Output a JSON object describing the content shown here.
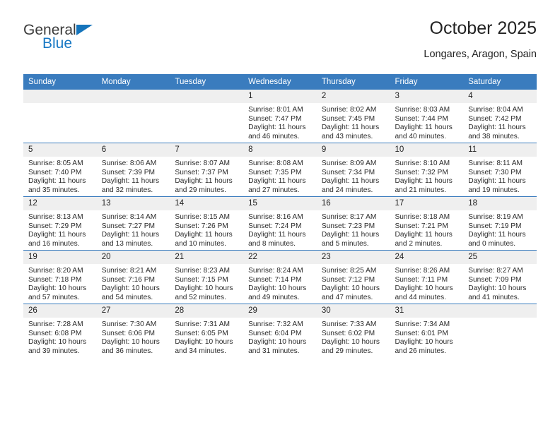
{
  "brand": {
    "name_top": "General",
    "name_bottom": "Blue",
    "accent_color": "#1878c4",
    "triangle_color": "#1574bb"
  },
  "header": {
    "title": "October 2025",
    "subtitle": "Longares, Aragon, Spain"
  },
  "theme": {
    "header_row_bg": "#3a7cbe",
    "daynum_bg": "#efefef",
    "cell_bg": "#ffffff",
    "text_color": "#2b2b2b"
  },
  "weekdays": [
    "Sunday",
    "Monday",
    "Tuesday",
    "Wednesday",
    "Thursday",
    "Friday",
    "Saturday"
  ],
  "weeks": [
    [
      {
        "day": "",
        "empty": true
      },
      {
        "day": "",
        "empty": true
      },
      {
        "day": "",
        "empty": true
      },
      {
        "day": "1",
        "sunrise": "Sunrise: 8:01 AM",
        "sunset": "Sunset: 7:47 PM",
        "daylight_1": "Daylight: 11 hours",
        "daylight_2": "and 46 minutes."
      },
      {
        "day": "2",
        "sunrise": "Sunrise: 8:02 AM",
        "sunset": "Sunset: 7:45 PM",
        "daylight_1": "Daylight: 11 hours",
        "daylight_2": "and 43 minutes."
      },
      {
        "day": "3",
        "sunrise": "Sunrise: 8:03 AM",
        "sunset": "Sunset: 7:44 PM",
        "daylight_1": "Daylight: 11 hours",
        "daylight_2": "and 40 minutes."
      },
      {
        "day": "4",
        "sunrise": "Sunrise: 8:04 AM",
        "sunset": "Sunset: 7:42 PM",
        "daylight_1": "Daylight: 11 hours",
        "daylight_2": "and 38 minutes."
      }
    ],
    [
      {
        "day": "5",
        "sunrise": "Sunrise: 8:05 AM",
        "sunset": "Sunset: 7:40 PM",
        "daylight_1": "Daylight: 11 hours",
        "daylight_2": "and 35 minutes."
      },
      {
        "day": "6",
        "sunrise": "Sunrise: 8:06 AM",
        "sunset": "Sunset: 7:39 PM",
        "daylight_1": "Daylight: 11 hours",
        "daylight_2": "and 32 minutes."
      },
      {
        "day": "7",
        "sunrise": "Sunrise: 8:07 AM",
        "sunset": "Sunset: 7:37 PM",
        "daylight_1": "Daylight: 11 hours",
        "daylight_2": "and 29 minutes."
      },
      {
        "day": "8",
        "sunrise": "Sunrise: 8:08 AM",
        "sunset": "Sunset: 7:35 PM",
        "daylight_1": "Daylight: 11 hours",
        "daylight_2": "and 27 minutes."
      },
      {
        "day": "9",
        "sunrise": "Sunrise: 8:09 AM",
        "sunset": "Sunset: 7:34 PM",
        "daylight_1": "Daylight: 11 hours",
        "daylight_2": "and 24 minutes."
      },
      {
        "day": "10",
        "sunrise": "Sunrise: 8:10 AM",
        "sunset": "Sunset: 7:32 PM",
        "daylight_1": "Daylight: 11 hours",
        "daylight_2": "and 21 minutes."
      },
      {
        "day": "11",
        "sunrise": "Sunrise: 8:11 AM",
        "sunset": "Sunset: 7:30 PM",
        "daylight_1": "Daylight: 11 hours",
        "daylight_2": "and 19 minutes."
      }
    ],
    [
      {
        "day": "12",
        "sunrise": "Sunrise: 8:13 AM",
        "sunset": "Sunset: 7:29 PM",
        "daylight_1": "Daylight: 11 hours",
        "daylight_2": "and 16 minutes."
      },
      {
        "day": "13",
        "sunrise": "Sunrise: 8:14 AM",
        "sunset": "Sunset: 7:27 PM",
        "daylight_1": "Daylight: 11 hours",
        "daylight_2": "and 13 minutes."
      },
      {
        "day": "14",
        "sunrise": "Sunrise: 8:15 AM",
        "sunset": "Sunset: 7:26 PM",
        "daylight_1": "Daylight: 11 hours",
        "daylight_2": "and 10 minutes."
      },
      {
        "day": "15",
        "sunrise": "Sunrise: 8:16 AM",
        "sunset": "Sunset: 7:24 PM",
        "daylight_1": "Daylight: 11 hours",
        "daylight_2": "and 8 minutes."
      },
      {
        "day": "16",
        "sunrise": "Sunrise: 8:17 AM",
        "sunset": "Sunset: 7:23 PM",
        "daylight_1": "Daylight: 11 hours",
        "daylight_2": "and 5 minutes."
      },
      {
        "day": "17",
        "sunrise": "Sunrise: 8:18 AM",
        "sunset": "Sunset: 7:21 PM",
        "daylight_1": "Daylight: 11 hours",
        "daylight_2": "and 2 minutes."
      },
      {
        "day": "18",
        "sunrise": "Sunrise: 8:19 AM",
        "sunset": "Sunset: 7:19 PM",
        "daylight_1": "Daylight: 11 hours",
        "daylight_2": "and 0 minutes."
      }
    ],
    [
      {
        "day": "19",
        "sunrise": "Sunrise: 8:20 AM",
        "sunset": "Sunset: 7:18 PM",
        "daylight_1": "Daylight: 10 hours",
        "daylight_2": "and 57 minutes."
      },
      {
        "day": "20",
        "sunrise": "Sunrise: 8:21 AM",
        "sunset": "Sunset: 7:16 PM",
        "daylight_1": "Daylight: 10 hours",
        "daylight_2": "and 54 minutes."
      },
      {
        "day": "21",
        "sunrise": "Sunrise: 8:23 AM",
        "sunset": "Sunset: 7:15 PM",
        "daylight_1": "Daylight: 10 hours",
        "daylight_2": "and 52 minutes."
      },
      {
        "day": "22",
        "sunrise": "Sunrise: 8:24 AM",
        "sunset": "Sunset: 7:14 PM",
        "daylight_1": "Daylight: 10 hours",
        "daylight_2": "and 49 minutes."
      },
      {
        "day": "23",
        "sunrise": "Sunrise: 8:25 AM",
        "sunset": "Sunset: 7:12 PM",
        "daylight_1": "Daylight: 10 hours",
        "daylight_2": "and 47 minutes."
      },
      {
        "day": "24",
        "sunrise": "Sunrise: 8:26 AM",
        "sunset": "Sunset: 7:11 PM",
        "daylight_1": "Daylight: 10 hours",
        "daylight_2": "and 44 minutes."
      },
      {
        "day": "25",
        "sunrise": "Sunrise: 8:27 AM",
        "sunset": "Sunset: 7:09 PM",
        "daylight_1": "Daylight: 10 hours",
        "daylight_2": "and 41 minutes."
      }
    ],
    [
      {
        "day": "26",
        "sunrise": "Sunrise: 7:28 AM",
        "sunset": "Sunset: 6:08 PM",
        "daylight_1": "Daylight: 10 hours",
        "daylight_2": "and 39 minutes."
      },
      {
        "day": "27",
        "sunrise": "Sunrise: 7:30 AM",
        "sunset": "Sunset: 6:06 PM",
        "daylight_1": "Daylight: 10 hours",
        "daylight_2": "and 36 minutes."
      },
      {
        "day": "28",
        "sunrise": "Sunrise: 7:31 AM",
        "sunset": "Sunset: 6:05 PM",
        "daylight_1": "Daylight: 10 hours",
        "daylight_2": "and 34 minutes."
      },
      {
        "day": "29",
        "sunrise": "Sunrise: 7:32 AM",
        "sunset": "Sunset: 6:04 PM",
        "daylight_1": "Daylight: 10 hours",
        "daylight_2": "and 31 minutes."
      },
      {
        "day": "30",
        "sunrise": "Sunrise: 7:33 AM",
        "sunset": "Sunset: 6:02 PM",
        "daylight_1": "Daylight: 10 hours",
        "daylight_2": "and 29 minutes."
      },
      {
        "day": "31",
        "sunrise": "Sunrise: 7:34 AM",
        "sunset": "Sunset: 6:01 PM",
        "daylight_1": "Daylight: 10 hours",
        "daylight_2": "and 26 minutes."
      },
      {
        "day": "",
        "empty": true
      }
    ]
  ]
}
